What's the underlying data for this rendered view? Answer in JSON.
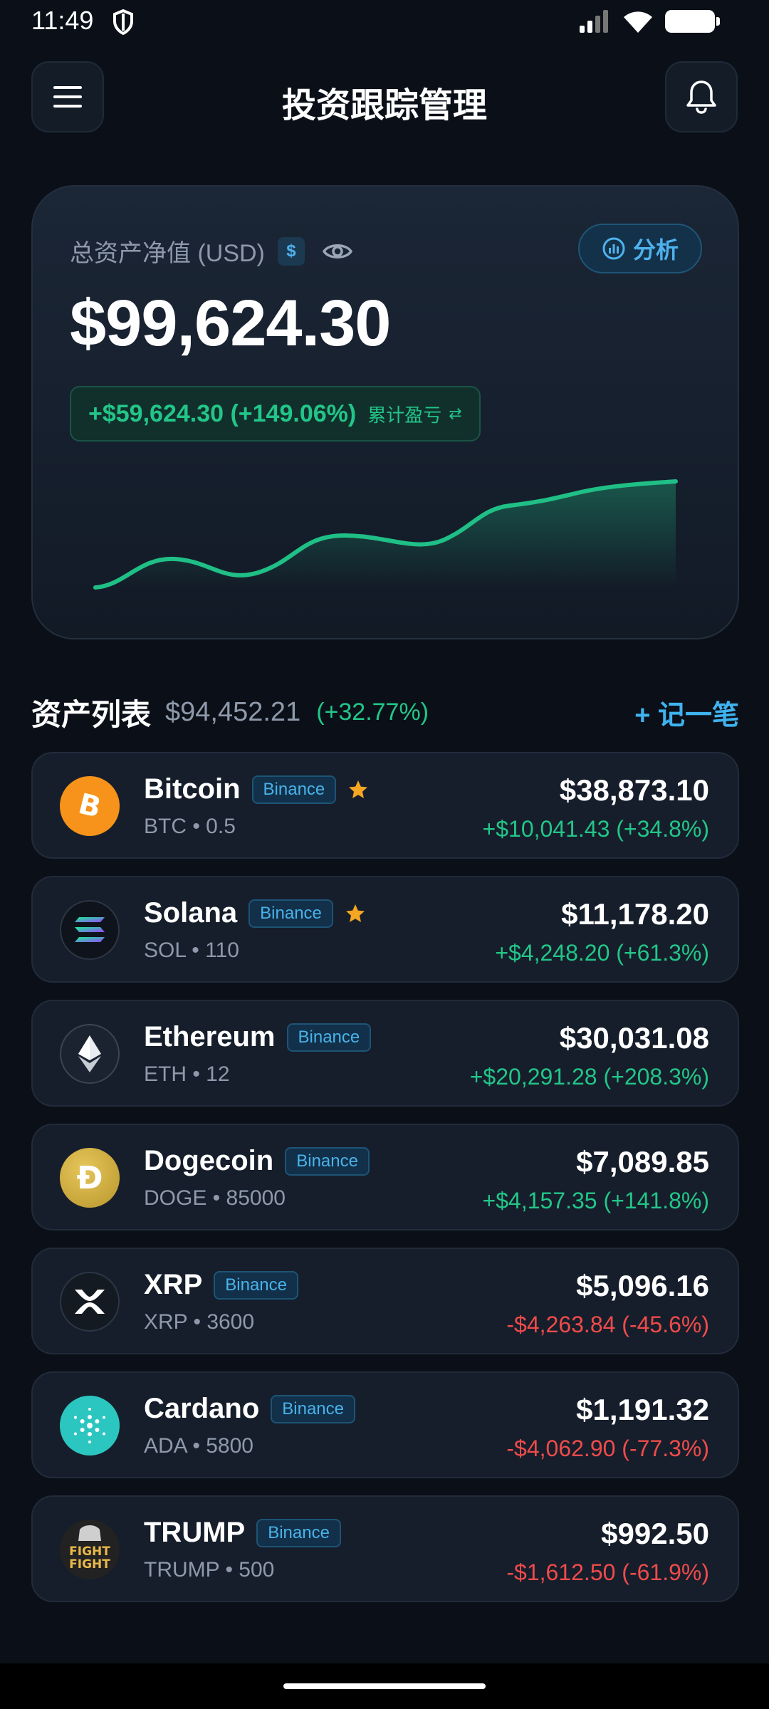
{
  "status": {
    "time": "11:49"
  },
  "header": {
    "title": "投资跟踪管理"
  },
  "summary": {
    "label": "总资产净值 (USD)",
    "currency_badge": "$",
    "analyze_label": "分析",
    "net_value": "$99,624.30",
    "gain": "+$59,624.30 (+149.06%)",
    "gain_label": "累计盈亏",
    "swap_icon": "⇄"
  },
  "assets_header": {
    "title": "资产列表",
    "total": "$94,452.21",
    "change": "(+32.77%)",
    "add_label": "+ 记一笔"
  },
  "assets": [
    {
      "name": "Bitcoin",
      "exchange": "Binance",
      "starred": true,
      "sub": "BTC • 0.5",
      "value": "$38,873.10",
      "change": "+$10,041.43 (+34.8%)",
      "direction": "up",
      "icon": "bitcoin-icon"
    },
    {
      "name": "Solana",
      "exchange": "Binance",
      "starred": true,
      "sub": "SOL • 110",
      "value": "$11,178.20",
      "change": "+$4,248.20 (+61.3%)",
      "direction": "up",
      "icon": "solana-icon"
    },
    {
      "name": "Ethereum",
      "exchange": "Binance",
      "starred": false,
      "sub": "ETH • 12",
      "value": "$30,031.08",
      "change": "+$20,291.28 (+208.3%)",
      "direction": "up",
      "icon": "ethereum-icon"
    },
    {
      "name": "Dogecoin",
      "exchange": "Binance",
      "starred": false,
      "sub": "DOGE • 85000",
      "value": "$7,089.85",
      "change": "+$4,157.35 (+141.8%)",
      "direction": "up",
      "icon": "dogecoin-icon"
    },
    {
      "name": "XRP",
      "exchange": "Binance",
      "starred": false,
      "sub": "XRP • 3600",
      "value": "$5,096.16",
      "change": "-$4,263.84 (-45.6%)",
      "direction": "down",
      "icon": "xrp-icon"
    },
    {
      "name": "Cardano",
      "exchange": "Binance",
      "starred": false,
      "sub": "ADA • 5800",
      "value": "$1,191.32",
      "change": "-$4,062.90 (-77.3%)",
      "direction": "down",
      "icon": "cardano-icon"
    },
    {
      "name": "TRUMP",
      "exchange": "Binance",
      "starred": false,
      "sub": "TRUMP • 500",
      "value": "$992.50",
      "change": "-$1,612.50 (-61.9%)",
      "direction": "down",
      "icon": "trump-icon"
    }
  ],
  "trump_logo_text": "FIGHT FIGHT"
}
